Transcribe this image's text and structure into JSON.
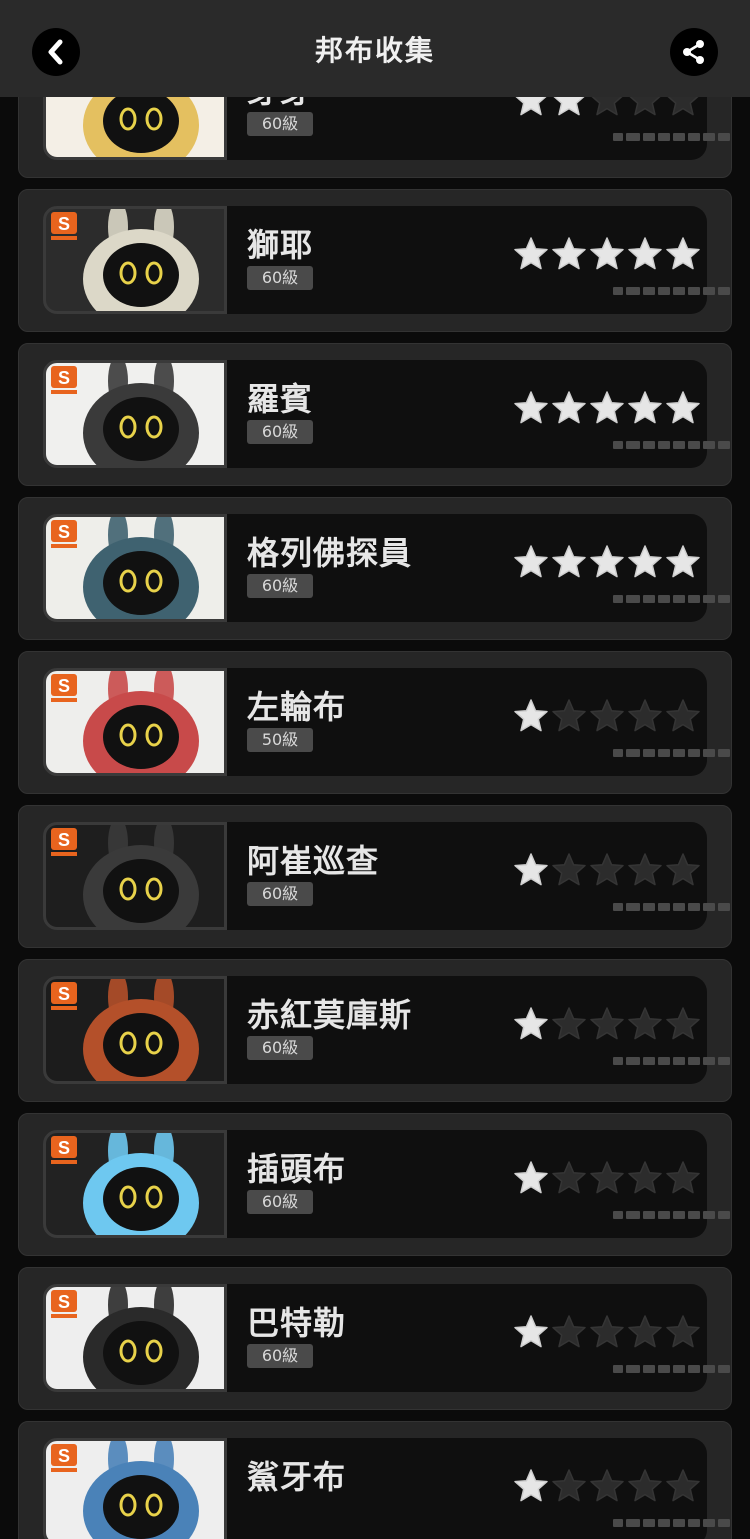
{
  "header": {
    "title": "邦布收集",
    "back_icon": "chevron-left-icon",
    "share_icon": "share-icon"
  },
  "colors": {
    "star_on": "#e6e6e6",
    "star_off": "#2c2c2c",
    "rank_badge": "#e8641e"
  },
  "rank_label": "S",
  "bangboos": [
    {
      "name": "芽芽",
      "level": "60級",
      "stars": 2,
      "bg": "#f4efe6",
      "accent": "#e4c060"
    },
    {
      "name": "獅耶",
      "level": "60級",
      "stars": 5,
      "bg": "#2c2c2c",
      "accent": "#dcd8c8"
    },
    {
      "name": "羅賓",
      "level": "60級",
      "stars": 5,
      "bg": "#f0f0ee",
      "accent": "#3a3a3a"
    },
    {
      "name": "格列佛探員",
      "level": "60級",
      "stars": 5,
      "bg": "#eeeeea",
      "accent": "#3f6270"
    },
    {
      "name": "左輪布",
      "level": "50級",
      "stars": 1,
      "bg": "#eeeeec",
      "accent": "#c84a4a"
    },
    {
      "name": "阿崔巡查",
      "level": "60級",
      "stars": 1,
      "bg": "#1e1e1e",
      "accent": "#3a3a3a"
    },
    {
      "name": "赤紅莫庫斯",
      "level": "60級",
      "stars": 1,
      "bg": "#1c1c1c",
      "accent": "#b4502a"
    },
    {
      "name": "插頭布",
      "level": "60級",
      "stars": 1,
      "bg": "#222222",
      "accent": "#6ec8f0"
    },
    {
      "name": "巴特勒",
      "level": "60級",
      "stars": 1,
      "bg": "#eeeeee",
      "accent": "#2a2a2a"
    },
    {
      "name": "鯊牙布",
      "level": "",
      "stars": 1,
      "bg": "#eeeeee",
      "accent": "#4a82b8"
    }
  ]
}
